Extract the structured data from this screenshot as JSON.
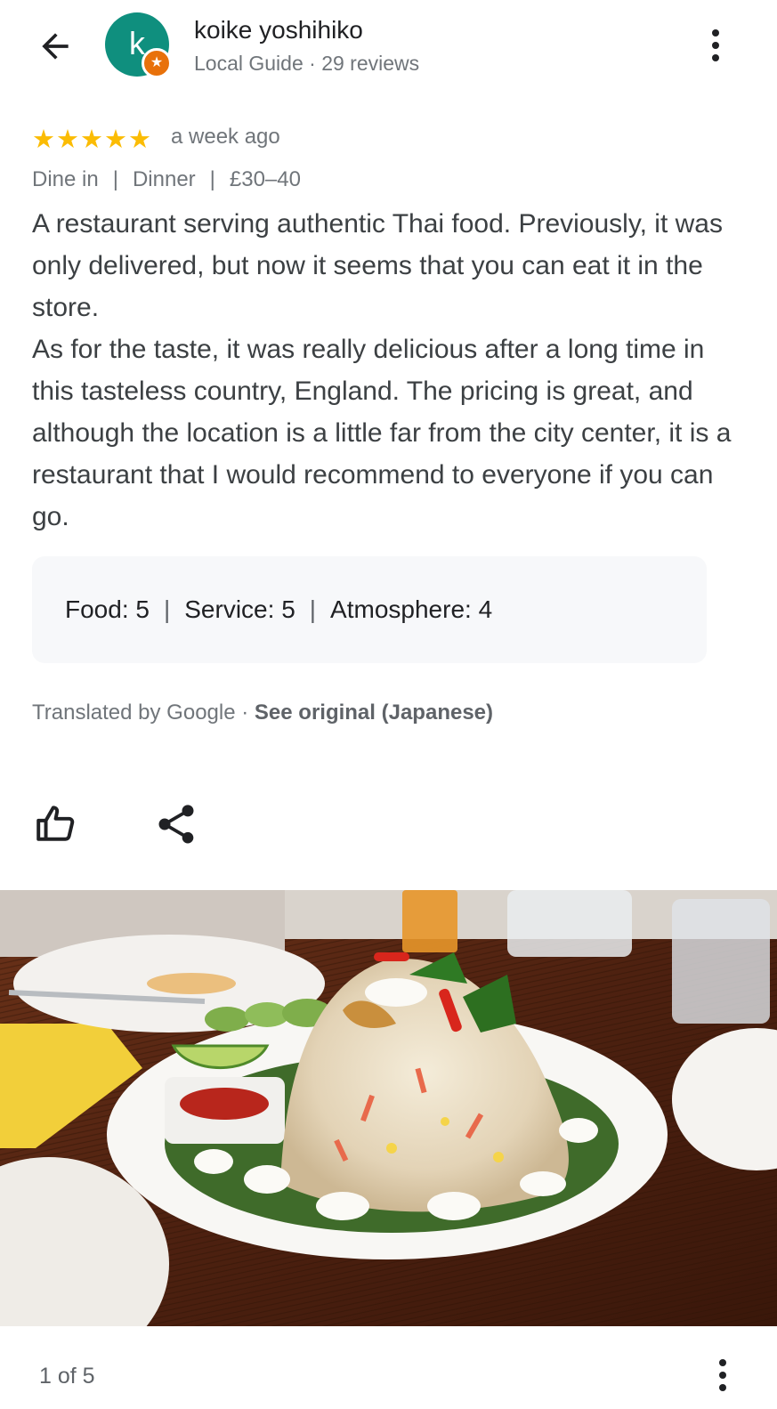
{
  "author": {
    "initial": "k",
    "name": "koike yoshihiko",
    "meta": "Local Guide · 29 reviews",
    "badge_glyph": "★"
  },
  "review": {
    "stars": "★★★★★",
    "rating": 5,
    "time": "a week ago",
    "tags": [
      "Dine in",
      "Dinner",
      "£30–40"
    ],
    "tag_separator": "|",
    "paragraphs": [
      "A restaurant serving authentic Thai food. Previously, it was only delivered, but now it seems that you can eat it in the store.",
      "As for the taste, it was really delicious after a long time in this tasteless country, England. The pricing is great, and although the location is a little far from the city center, it is a restaurant that I would recommend to everyone if you can go."
    ],
    "ratings": {
      "food_label": "Food:",
      "food_value": "5",
      "service_label": "Service:",
      "service_value": "5",
      "atmosphere_label": "Atmosphere:",
      "atmosphere_value": "4",
      "separator": "|"
    },
    "translation": {
      "prefix": "Translated by Google · ",
      "link": "See original (Japanese)"
    }
  },
  "photo": {
    "counter": "1 of 5"
  },
  "icons": {
    "back": "arrow-left-icon",
    "more": "more-vert-icon",
    "like": "thumb-up-icon",
    "share": "share-icon"
  },
  "colors": {
    "avatar": "#0f8f7e",
    "badge": "#e8710a",
    "stars": "#fbbc04",
    "ratings_box": "#f7f8fa"
  }
}
